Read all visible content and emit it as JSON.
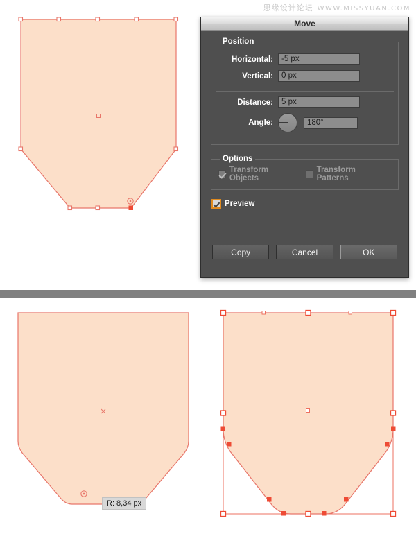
{
  "watermark": {
    "forum": "思缘设计论坛",
    "url": "WWW.MISSYUAN.COM"
  },
  "dialog": {
    "title": "Move",
    "groups": {
      "position": {
        "legend": "Position",
        "fields": [
          {
            "label": "Horizontal:",
            "value": "-5 px"
          },
          {
            "label": "Vertical:",
            "value": "0 px"
          }
        ],
        "distance": {
          "label": "Distance:",
          "value": "5 px"
        },
        "angle": {
          "label": "Angle:",
          "value": "180°",
          "dial_degrees": 180
        }
      },
      "options": {
        "legend": "Options",
        "checkboxes": [
          {
            "label": "Transform Objects",
            "checked": true,
            "enabled": false
          },
          {
            "label": "Transform Patterns",
            "checked": false,
            "enabled": false
          }
        ]
      }
    },
    "preview": {
      "label": "Preview",
      "checked": true
    },
    "buttons": [
      {
        "label": "Copy",
        "default": false
      },
      {
        "label": "Cancel",
        "default": false
      },
      {
        "label": "OK",
        "default": true
      }
    ]
  },
  "artwork": {
    "fill_color": "#FCDFC9",
    "stroke_color": "#E8766A",
    "selection_color": "#EE4B35",
    "anchor_fill": "#FFFFFF",
    "top_left_shape": {
      "name": "shield-shape-selected-points",
      "description": "pentagon shield with chamfered bottom corners, path anchor points visible"
    },
    "bottom_left_shape": {
      "name": "shield-shape-rounded-corners",
      "description": "same shield with live-corner rounding applied"
    },
    "bottom_right_shape": {
      "name": "shield-shape-bounding-box",
      "description": "rounded shield with selection bounding box and all anchors selected"
    }
  },
  "tooltip": {
    "radius_label": "R: 8,34 px"
  }
}
